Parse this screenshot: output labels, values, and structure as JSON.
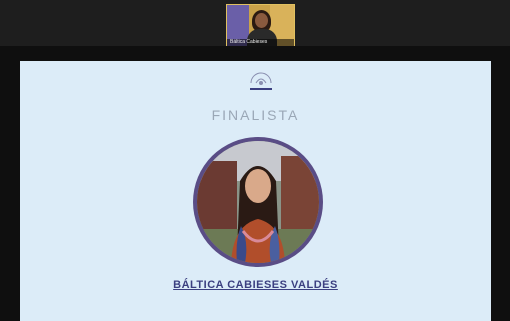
{
  "participant": {
    "name_label": "Báltica Cabieses"
  },
  "slide": {
    "logo_text": "",
    "heading": "FINALISTA",
    "person_name": "BÁLTICA CABIESES VALDÉS"
  },
  "colors": {
    "slide_bg": "#dcecf8",
    "heading": "#9aa7b6",
    "name": "#3b3f80",
    "ring": "#5a4d86"
  },
  "icons": {
    "logo": "award-logo-icon"
  }
}
